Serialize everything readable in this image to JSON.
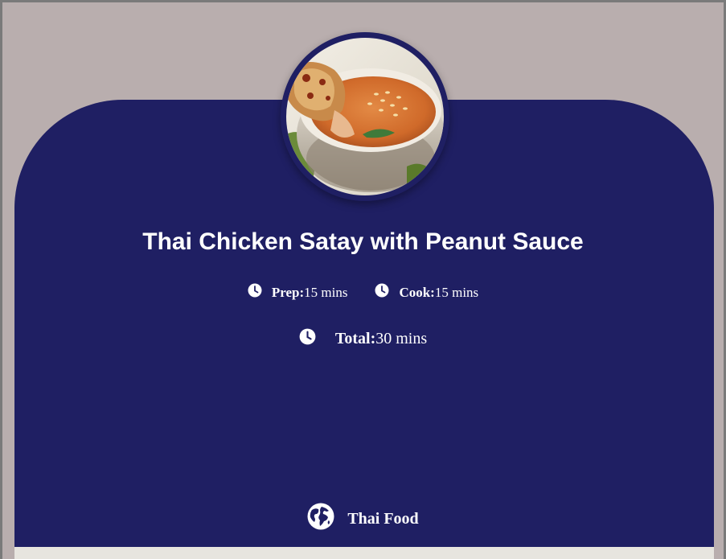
{
  "recipe": {
    "title": "Thai Chicken Satay with Peanut Sauce",
    "prep": {
      "label": "Prep:",
      "value": "15 mins",
      "icon": "clock-icon"
    },
    "cook": {
      "label": "Cook:",
      "value": "15 mins",
      "icon": "clock-icon"
    },
    "total": {
      "label": "Total:",
      "value": "30 mins",
      "icon": "clock-icon"
    },
    "cuisine": {
      "label": "Thai Food",
      "icon": "globe-icon"
    }
  },
  "colors": {
    "card": "#1f1f63",
    "page_background": "#b9aeae",
    "bottom_strip": "#e7e5df",
    "text": "#ffffff"
  }
}
